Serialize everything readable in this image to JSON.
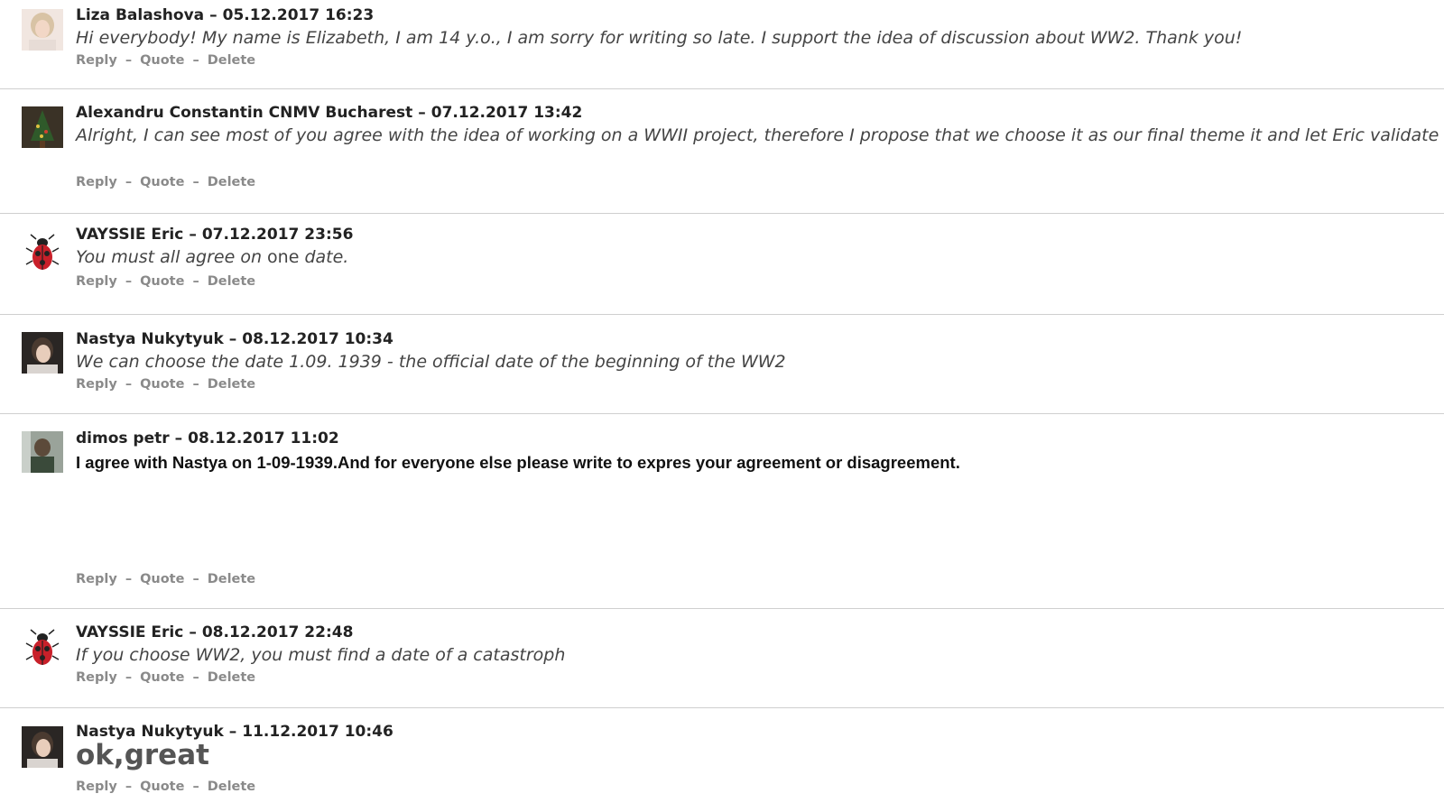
{
  "actions": {
    "reply": "Reply",
    "quote": "Quote",
    "delete": "Delete",
    "separator": "–"
  },
  "comments": [
    {
      "author": "Liza Balashova",
      "datetime": "05.12.2017 16:23",
      "text": "Hi everybody! My name is Elizabeth, I am 14 y.o., I am sorry for writing so late. I support the idea of discussion about WW2. Thank you!",
      "style": "italic"
    },
    {
      "author": "Alexandru Constantin CNMV Bucharest",
      "datetime": "07.12.2017 13:42",
      "text": "Alright, I can see most of you agree with the idea of working on a WWII project, therefore I propose that we choose it as our final theme it and let Eric validate it.",
      "style": "italic"
    },
    {
      "author": "VAYSSIE Eric",
      "datetime": "07.12.2017 23:56",
      "text_before": "You must all agree on ",
      "text_emphasis": "one",
      "text_after": " date.",
      "style": "italic"
    },
    {
      "author": "Nastya Nukytyuk",
      "datetime": "08.12.2017 10:34",
      "text": "We can choose the date 1.09. 1939 - the official date of the beginning of the WW2",
      "style": "italic"
    },
    {
      "author": "dimos petr",
      "datetime": "08.12.2017 11:02",
      "text": "I agree with Nastya on 1-09-1939.And for everyone else please write to expres your agreement or disagreement.",
      "style": "bold"
    },
    {
      "author": "VAYSSIE Eric",
      "datetime": "08.12.2017 22:48",
      "text": "If you choose WW2, you must find a date of a catastroph",
      "style": "italic"
    },
    {
      "author": "Nastya Nukytyuk",
      "datetime": "11.12.2017 10:46",
      "text": "ok,great",
      "style": "large"
    }
  ]
}
